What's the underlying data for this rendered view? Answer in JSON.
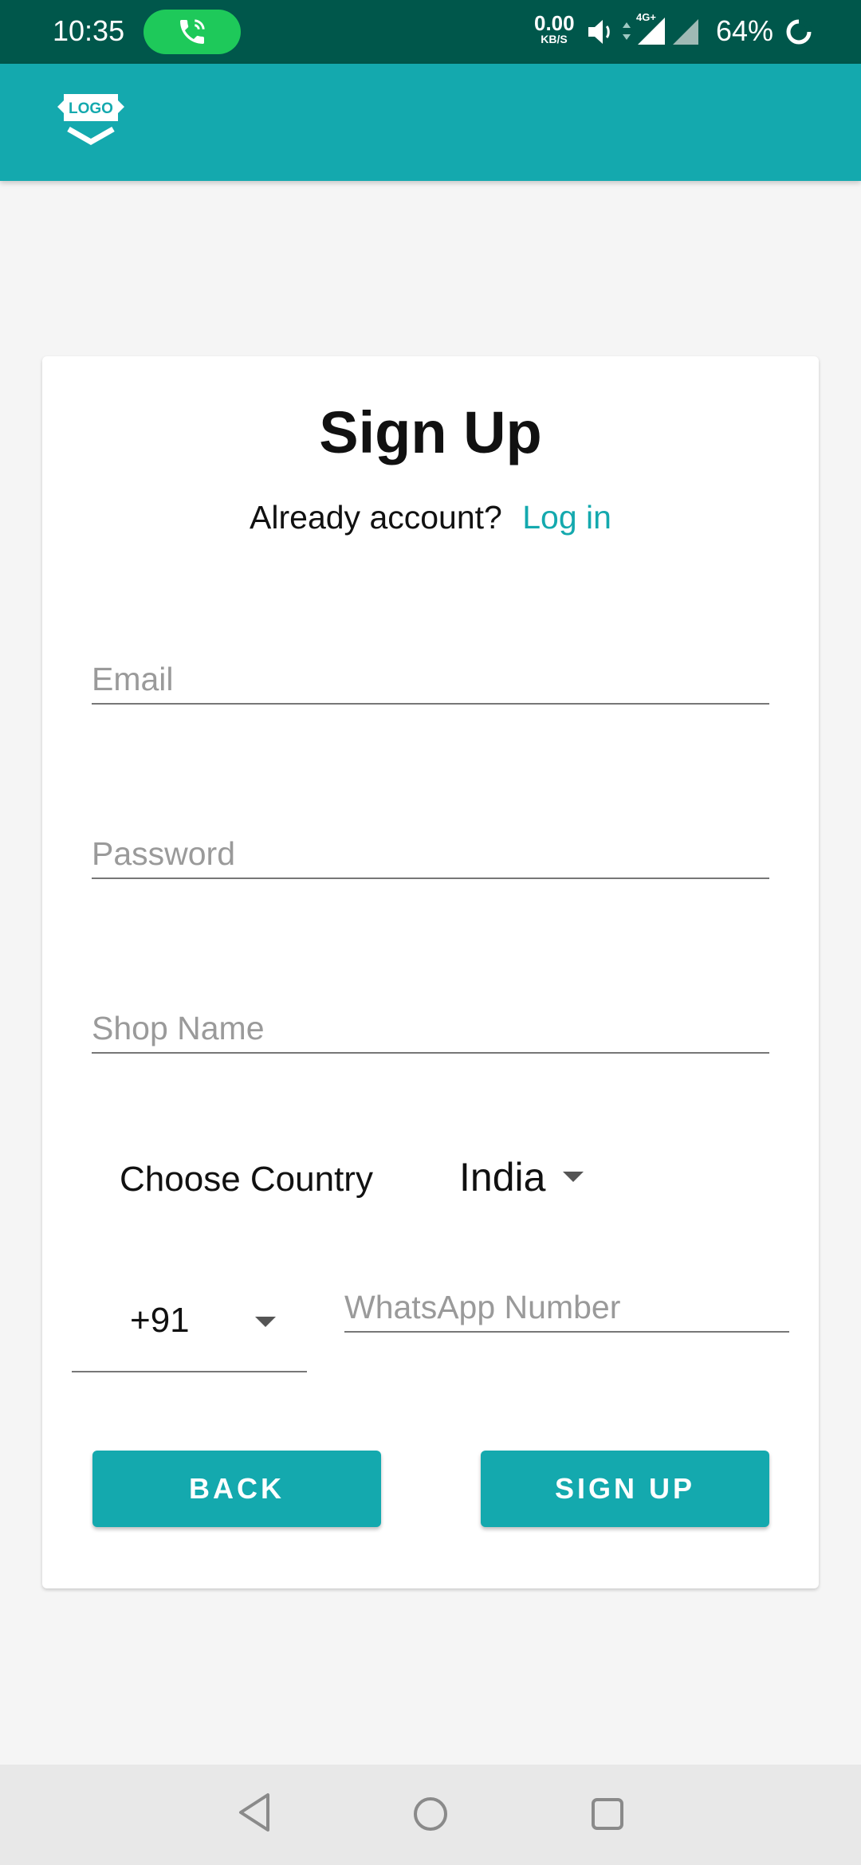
{
  "status_bar": {
    "time": "10:35",
    "net_speed_value": "0.00",
    "net_speed_unit": "KB/S",
    "network_label": "4G+",
    "battery": "64%"
  },
  "app_bar": {
    "logo_text": "LOGO",
    "background_color": "#14a9ae"
  },
  "signup": {
    "title": "Sign Up",
    "already_text": "Already account?",
    "login_link": "Log in",
    "email_placeholder": "Email",
    "password_placeholder": "Password",
    "shop_placeholder": "Shop Name",
    "choose_country_label": "Choose Country",
    "country_value": "India",
    "country_code": "+91",
    "whatsapp_placeholder": "WhatsApp Number",
    "back_button": "BACK",
    "signup_button": "SIGN UP"
  },
  "icons": {
    "call": "phone-call-icon",
    "volume": "volume-icon",
    "signal": "signal-icon",
    "battery": "battery-icon",
    "dropdown": "caret-down-icon",
    "nav_back": "nav-back-icon",
    "nav_home": "nav-home-icon",
    "nav_recent": "nav-recent-icon"
  },
  "colors": {
    "accent": "#14a9ae",
    "status_bar": "#00574b",
    "call_pill": "#1ec95a"
  }
}
